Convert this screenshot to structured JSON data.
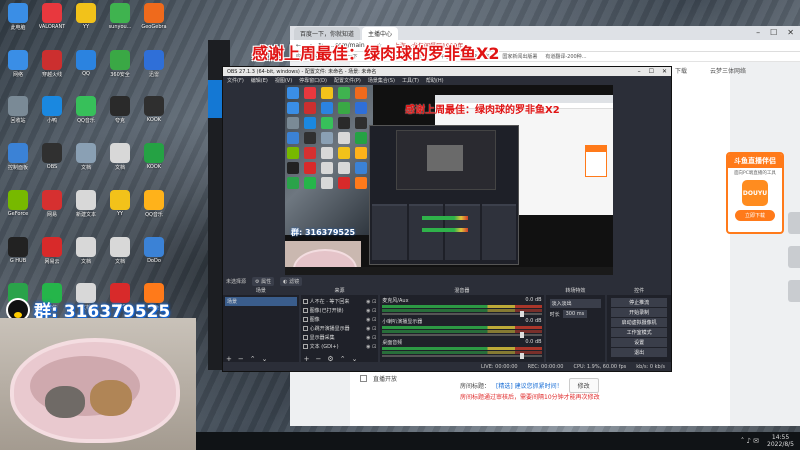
{
  "colors": {
    "accent": "#1a6fd6",
    "danger": "#e02b2b",
    "douyu": "#ff7a1a",
    "obs_bg": "#2b2e38"
  },
  "overlay": {
    "title": "感谢上周最佳：绿肉球的罗非鱼X2",
    "qq_group": "群: 316379525"
  },
  "desktop": {
    "icons": [
      {
        "label": "此电脑",
        "color": "#3a8ee6",
        "icon": "computer-icon"
      },
      {
        "label": "VALORANT",
        "color": "#e8383e",
        "icon": "valorant-icon"
      },
      {
        "label": "YY",
        "color": "#f2c21a",
        "icon": "yy-icon"
      },
      {
        "label": "sunyou...",
        "color": "#3fb34f",
        "icon": "app-icon"
      },
      {
        "label": "GeoGebra",
        "color": "#ef6a1c",
        "icon": "app-icon"
      },
      {
        "label": "网络",
        "color": "#3a8ee6",
        "icon": "network-icon"
      },
      {
        "label": "穿越火线",
        "color": "#cc2f2f",
        "icon": "game-icon"
      },
      {
        "label": "QQ",
        "color": "#2b83e0",
        "icon": "qq-icon"
      },
      {
        "label": "360安全",
        "color": "#3aa845",
        "icon": "app-icon"
      },
      {
        "label": "迅雷",
        "color": "#2f6fd8",
        "icon": "app-icon"
      },
      {
        "label": "回收站",
        "color": "#7a8a96",
        "icon": "recycle-bin-icon"
      },
      {
        "label": "小鸭",
        "color": "#1a88e0",
        "icon": "app-icon"
      },
      {
        "label": "QQ音乐",
        "color": "#37c05a",
        "icon": "app-icon"
      },
      {
        "label": "夸克",
        "color": "#2a2a2a",
        "icon": "app-icon"
      },
      {
        "label": "KOOK",
        "color": "#2f2f2f",
        "icon": "kook-icon"
      },
      {
        "label": "控制面板",
        "color": "#3b82d6",
        "icon": "control-panel-icon"
      },
      {
        "label": "OBS",
        "color": "#303030",
        "icon": "obs-icon"
      },
      {
        "label": "文档",
        "color": "#8aa0b4",
        "icon": "document-icon"
      },
      {
        "label": "文档",
        "color": "#d8d8d8",
        "icon": "document-icon"
      },
      {
        "label": "KOOK",
        "color": "#25a244",
        "icon": "kook-icon"
      },
      {
        "label": "GeForce",
        "color": "#77b900",
        "icon": "nvidia-icon"
      },
      {
        "label": "网易",
        "color": "#d63030",
        "icon": "app-icon"
      },
      {
        "label": "新建文本",
        "color": "#d8d8d8",
        "icon": "document-icon"
      },
      {
        "label": "YY",
        "color": "#f2c21a",
        "icon": "yy-icon"
      },
      {
        "label": "QQ音乐",
        "color": "#ffb21a",
        "icon": "app-icon"
      },
      {
        "label": "G HUB",
        "color": "#222222",
        "icon": "logitech-icon"
      },
      {
        "label": "网易云",
        "color": "#d82a2a",
        "icon": "app-icon"
      },
      {
        "label": "文档",
        "color": "#d8d8d8",
        "icon": "document-icon"
      },
      {
        "label": "文档",
        "color": "#d8d8d8",
        "icon": "document-icon"
      },
      {
        "label": "DoDo",
        "color": "#3b82d6",
        "icon": "app-icon"
      },
      {
        "label": "快剪",
        "color": "#2aa34a",
        "icon": "app-icon"
      },
      {
        "label": "微信",
        "color": "#25b54a",
        "icon": "wechat-icon"
      },
      {
        "label": "文档",
        "color": "#d8d8d8",
        "icon": "document-icon"
      },
      {
        "label": "WPS",
        "color": "#d82a2a",
        "icon": "wps-icon"
      },
      {
        "label": "斗鱼",
        "color": "#ff7a1a",
        "icon": "app-icon"
      }
    ]
  },
  "browser": {
    "tabs": [
      "百度一下，你就知道",
      "主播中心"
    ],
    "url": "...com/main",
    "extensions_text": "上海一龙包间餐厅1999年…",
    "bookmarks": [
      "应用",
      "Select",
      "百度一下",
      "斗鱼",
      "ProSettings.net",
      "主播中心",
      "VALORANT官方",
      "国家新闻出版署",
      "有道翻译-200种…"
    ],
    "download_label": "下载",
    "user_label": "云梦三体网络",
    "page": {
      "checkbox_label": "直播开放",
      "prompt_label": "房间标题：",
      "link_text": "[精选] 建议您抓紧时间！",
      "modify_button": "修改",
      "warning": "房间标题通过审核后，需要间隔10分钟才能再次修改"
    }
  },
  "douyu_ad": {
    "header": "斗鱼直播伴侣",
    "subtitle": "面向PC端直播的工具",
    "logo_text": "DOUYU",
    "button": "立即下载"
  },
  "obs": {
    "title": "OBS 27.1.3 (64-bit, windows) - 配置文件: 未命名 - 场景: 未命名",
    "menu": [
      "文件(F)",
      "编辑(E)",
      "视图(V)",
      "停靠窗口(D)",
      "配置文件(P)",
      "场景集合(S)",
      "工具(T)",
      "帮助(H)"
    ],
    "source_bar": {
      "label": "未选择源",
      "props": "属性",
      "filters": "滤镜"
    },
    "docks": {
      "scenes": {
        "title": "场景",
        "items": [
          "场景"
        ]
      },
      "sources": {
        "title": "来源",
        "items": [
          "人不在 · 等下回来",
          "图像(已打开锁)",
          "图像",
          "心跳开演播显示器",
          "显示器采集",
          "文本 (GDI+)"
        ]
      },
      "mixer": {
        "title": "混音器",
        "channels": [
          {
            "name": "麦克风/Aux",
            "db": "0.0 dB"
          },
          {
            "name": "小喇叭演播显示器",
            "db": "0.0 dB"
          },
          {
            "name": "桌面音频",
            "db": "0.0 dB"
          }
        ]
      },
      "transitions": {
        "title": "转场特效",
        "selected": "淡入淡出",
        "duration_label": "时长",
        "duration": "300 ms"
      },
      "controls": {
        "title": "控件",
        "buttons": [
          "停止推流",
          "开始录制",
          "启动虚拟摄像机",
          "工作室模式",
          "设置",
          "退出"
        ]
      }
    },
    "status": {
      "live": "LIVE: 00:00:00",
      "rec": "REC: 00:00:00",
      "cpu": "CPU: 1.9%, 60.00 fps",
      "kbps": "kb/s: 0 kb/s"
    }
  },
  "taskbar": {
    "time": "14:55",
    "date": "2022/8/5"
  }
}
